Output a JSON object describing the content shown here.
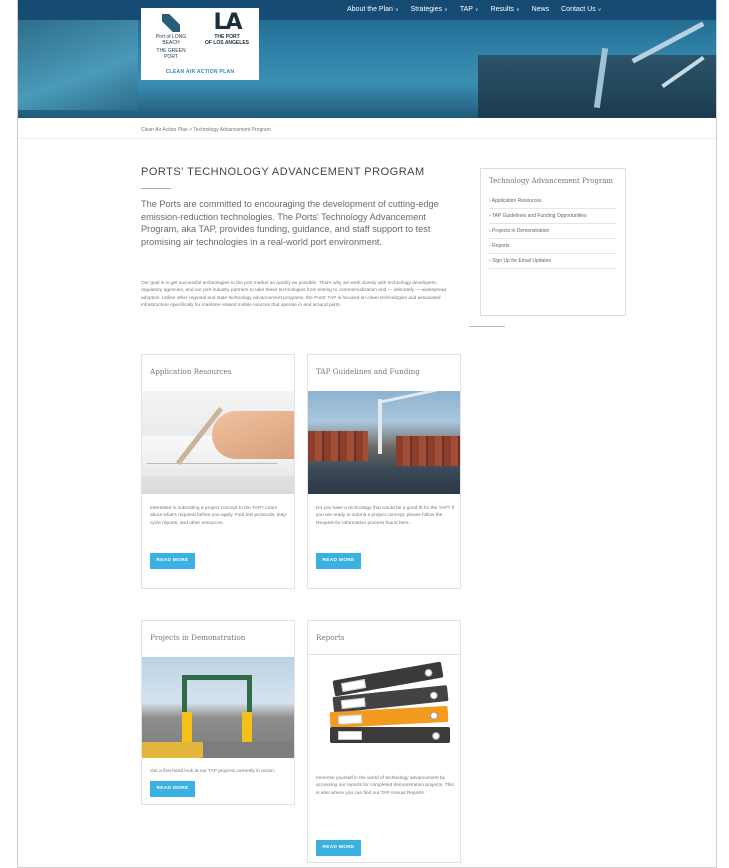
{
  "nav": {
    "items": [
      "About the Plan",
      "Strategies",
      "TAP",
      "Results",
      "News",
      "Contact Us"
    ],
    "has_caret": [
      true,
      true,
      true,
      true,
      false,
      true
    ]
  },
  "logo": {
    "longbeach": "Port of LONG BEACH",
    "longbeach_sub": "THE GREEN PORT",
    "la_mark": "LA",
    "la_name": "THE PORT",
    "la_sub": "OF LOS ANGELES",
    "caption": "CLEAN AIR ACTION PLAN"
  },
  "breadcrumb": "Clean Air Action Plan > Technology Advancement Program",
  "main": {
    "title": "PORTS' TECHNOLOGY ADVANCEMENT PROGRAM",
    "lead": "The Ports are committed to encouraging the development of cutting-edge emission-reduction technologies. The Ports' Technology Advancement Program, aka TAP, provides funding, guidance, and staff support to test promising air technologies in a real-world port environment.",
    "body": "Our goal is to get successful technologies to the port market as quickly as possible. That's why we work closely with technology developers, regulatory agencies, and our port industry partners to take these technologies from testing to commercialization and — ultimately — widespread adoption. Unlike other regional and state technology advancement programs, the Ports' TAP is focused on clean technologies and associated infrastructure specifically for maritime-related mobile sources that operate in and around ports."
  },
  "sidebar": {
    "title": "Technology Advancement Program",
    "items": [
      "› Application Resources",
      "› TAP Guidelines and Funding Opportunities",
      "› Projects in Demonstration",
      "› Reports",
      "› Sign Up for Email Updates"
    ]
  },
  "cards": [
    {
      "title": "Application Resources",
      "text": "Interested in submitting a project concept to the TAP? Learn about what's required before you apply. Find test protocols, duty-cycle reports, and other resources.",
      "button": "READ MORE"
    },
    {
      "title": "TAP Guidelines and Funding",
      "text": "Do you have a technology that would be a good fit for the TAP? If you are ready to submit a project concept, please follow the Request for Information process found here.",
      "button": "READ MORE"
    },
    {
      "title": "Projects in Demonstration",
      "text": "Get a first-hand look at our TAP projects currently in action.",
      "button": "READ MORE"
    },
    {
      "title": "Reports",
      "text": "Immerse yourself in the world of technology advancement by accessing our reports for completed demonstration projects. This is also where you can find our TAP Annual Reports.",
      "button": "READ MORE"
    }
  ],
  "colors": {
    "accent": "#3bb1e1",
    "header": "#1f5f84"
  }
}
